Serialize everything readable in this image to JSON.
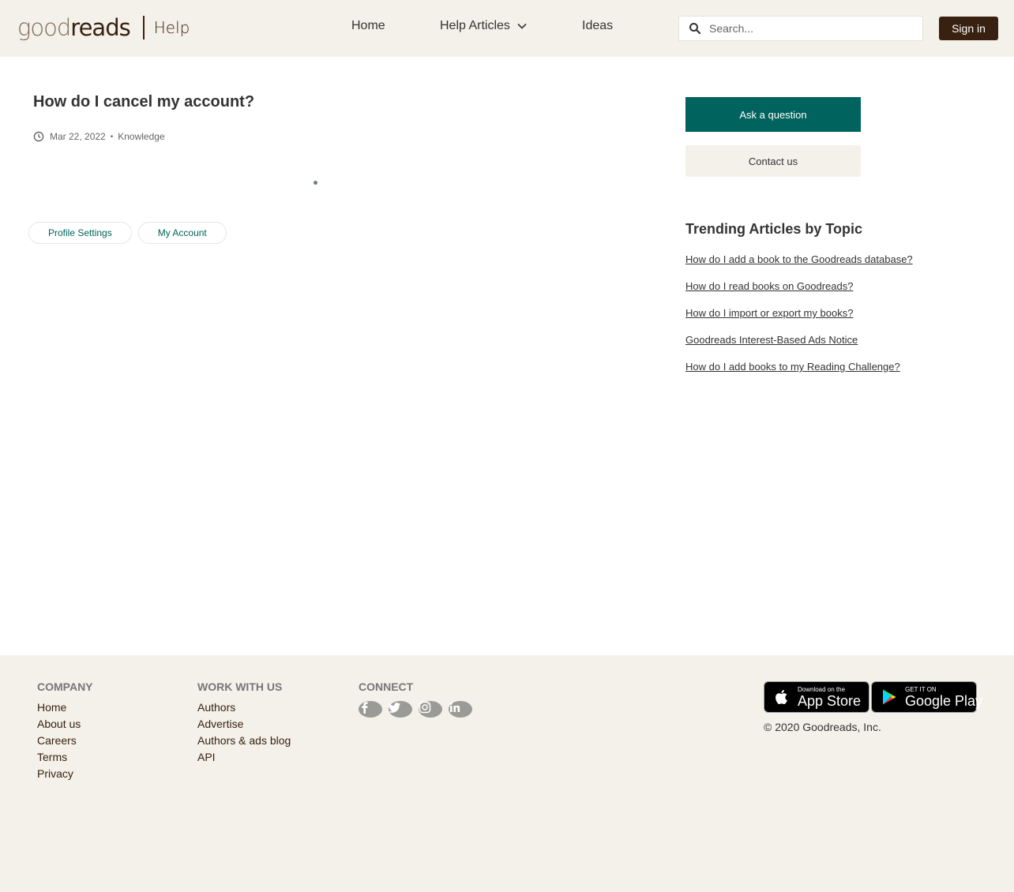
{
  "header": {
    "logo_light": "good",
    "logo_bold": "reads",
    "logo_help": "Help",
    "nav": {
      "home": "Home",
      "help_articles": "Help Articles",
      "ideas": "Ideas"
    },
    "search_placeholder": "Search...",
    "sign_in": "Sign in"
  },
  "article": {
    "title": "How do I cancel my account?",
    "date": "Mar 22, 2022",
    "type": "Knowledge",
    "topics": [
      "Profile Settings",
      "My Account"
    ]
  },
  "sidebar": {
    "ask_question": "Ask a question",
    "contact_us": "Contact us",
    "trending_title": "Trending Articles by Topic",
    "trending": [
      "How do I add a book to the Goodreads database?",
      "How do I read books on Goodreads?",
      "How do I import or export my books?",
      "Goodreads Interest-Based Ads Notice",
      "How do I add books to my Reading Challenge?"
    ]
  },
  "footer": {
    "company": {
      "heading": "Company",
      "links": [
        "Home",
        "About us",
        "Careers",
        "Terms",
        "Privacy"
      ]
    },
    "work": {
      "heading": "Work with us",
      "links": [
        "Authors",
        "Advertise",
        "Authors & ads blog",
        "API"
      ]
    },
    "connect": {
      "heading": "Connect",
      "icons": [
        "facebook-icon",
        "twitter-icon",
        "instagram-icon",
        "linkedin-icon"
      ]
    },
    "app_store": {
      "small": "Download on the",
      "big": "App Store"
    },
    "google_play": {
      "small": "GET IT ON",
      "big": "Google Play"
    },
    "copyright": "© 2020 Goodreads, Inc."
  },
  "colors": {
    "brand_brown": "#382110",
    "teal": "#00635d",
    "beige": "#f4f1ea"
  }
}
